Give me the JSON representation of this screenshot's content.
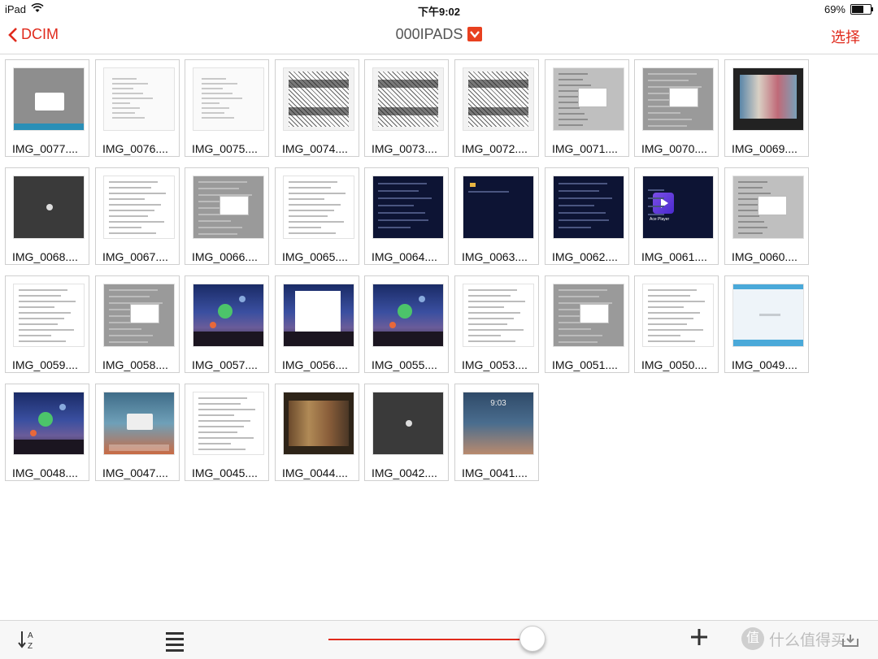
{
  "status_bar": {
    "device": "iPad",
    "time": "下午9:02",
    "battery": "69%",
    "battery_level": 0.69
  },
  "navbar": {
    "back_label": "DCIM",
    "title": "000IPADS",
    "select_label": "选择"
  },
  "files": [
    {
      "name": "IMG_0077....",
      "kind": "gray"
    },
    {
      "name": "IMG_0076....",
      "kind": "white"
    },
    {
      "name": "IMG_0075....",
      "kind": "white"
    },
    {
      "name": "IMG_0074....",
      "kind": "manga"
    },
    {
      "name": "IMG_0073....",
      "kind": "manga"
    },
    {
      "name": "IMG_0072....",
      "kind": "manga"
    },
    {
      "name": "IMG_0071....",
      "kind": "list-popup"
    },
    {
      "name": "IMG_0070....",
      "kind": "list-gray"
    },
    {
      "name": "IMG_0069....",
      "kind": "video"
    },
    {
      "name": "IMG_0068....",
      "kind": "dark"
    },
    {
      "name": "IMG_0067....",
      "kind": "list"
    },
    {
      "name": "IMG_0066....",
      "kind": "list-gray"
    },
    {
      "name": "IMG_0065....",
      "kind": "list"
    },
    {
      "name": "IMG_0064....",
      "kind": "navy"
    },
    {
      "name": "IMG_0063....",
      "kind": "navy-folder"
    },
    {
      "name": "IMG_0062....",
      "kind": "navy"
    },
    {
      "name": "IMG_0061....",
      "kind": "navy-player"
    },
    {
      "name": "IMG_0060....",
      "kind": "list-popup"
    },
    {
      "name": "IMG_0059....",
      "kind": "list"
    },
    {
      "name": "IMG_0058....",
      "kind": "list-gray"
    },
    {
      "name": "IMG_0057....",
      "kind": "space"
    },
    {
      "name": "IMG_0056....",
      "kind": "space-dialog"
    },
    {
      "name": "IMG_0055....",
      "kind": "space"
    },
    {
      "name": "IMG_0053....",
      "kind": "list"
    },
    {
      "name": "IMG_0051....",
      "kind": "list-gray"
    },
    {
      "name": "IMG_0050....",
      "kind": "list"
    },
    {
      "name": "IMG_0049....",
      "kind": "blue"
    },
    {
      "name": "IMG_0048....",
      "kind": "space"
    },
    {
      "name": "IMG_0047....",
      "kind": "home"
    },
    {
      "name": "IMG_0045....",
      "kind": "list"
    },
    {
      "name": "IMG_0044....",
      "kind": "friends"
    },
    {
      "name": "IMG_0042....",
      "kind": "dark"
    },
    {
      "name": "IMG_0041....",
      "kind": "lock"
    }
  ],
  "lock_clock": "9:03",
  "player_label": "Ace Player",
  "toolbar": {
    "sort_icon": "sort-az-icon",
    "list_icon": "list-view-icon",
    "zoom_slider_value": 1.0,
    "add_icon": "plus-icon",
    "export_icon": "export-icon"
  },
  "watermark": {
    "badge": "值",
    "text": "什么值得买"
  },
  "colors": {
    "accent": "#e02a1c",
    "title_gray": "#555555"
  }
}
